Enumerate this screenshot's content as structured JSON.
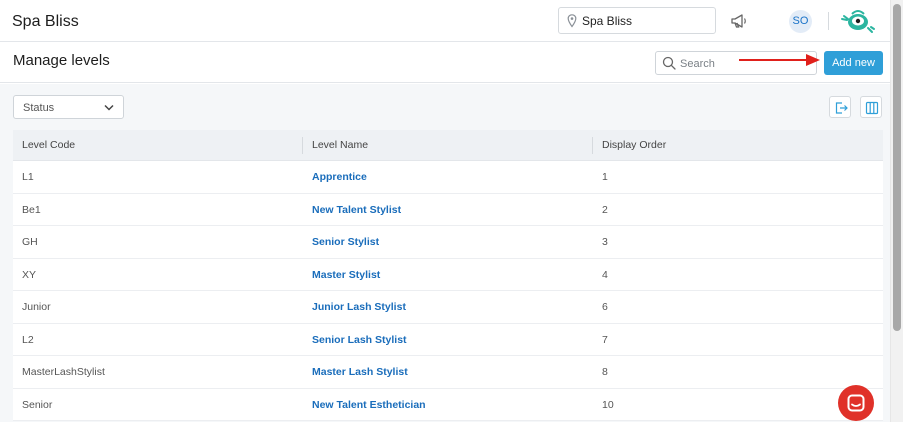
{
  "topbar": {
    "brand": "Spa Bliss",
    "location": "Spa Bliss",
    "avatar_initials": "SO"
  },
  "header": {
    "title": "Manage levels",
    "search_placeholder": "Search",
    "add_new_label": "Add new"
  },
  "filters": {
    "status_label": "Status"
  },
  "table": {
    "columns": [
      "Level Code",
      "Level Name",
      "Display Order"
    ],
    "rows": [
      {
        "code": "L1",
        "name": "Apprentice",
        "order": "1"
      },
      {
        "code": "Be1",
        "name": "New Talent Stylist",
        "order": "2"
      },
      {
        "code": "GH",
        "name": "Senior Stylist",
        "order": "3"
      },
      {
        "code": "XY",
        "name": "Master Stylist",
        "order": "4"
      },
      {
        "code": "Junior",
        "name": "Junior Lash Stylist",
        "order": "6"
      },
      {
        "code": "L2",
        "name": "Senior Lash Stylist",
        "order": "7"
      },
      {
        "code": "MasterLashStylist",
        "name": "Master Lash Stylist",
        "order": "8"
      },
      {
        "code": "Senior",
        "name": "New Talent Esthetician",
        "order": "10"
      }
    ]
  },
  "colors": {
    "accent": "#2f9fd8",
    "link": "#1a6dbb",
    "annotation_arrow": "#e0201b",
    "chat": "#e03129"
  }
}
